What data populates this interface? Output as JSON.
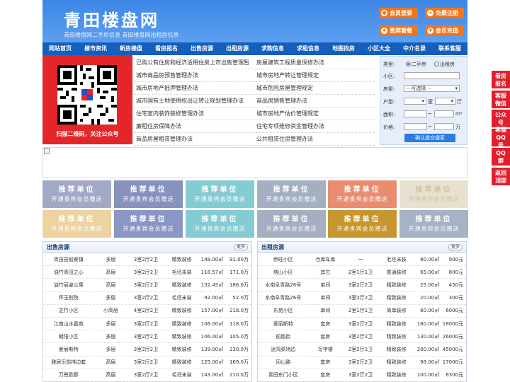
{
  "header": {
    "logo": "青田楼盘网",
    "slogan": "青田楼盘网二手房信息    青田楼盘网出租房信息",
    "buttons": [
      "会员登录",
      "免费注册",
      "贵宾套餐",
      "金币充值"
    ]
  },
  "nav": [
    "网站首页",
    "楼市资讯",
    "新房楼盘",
    "看房报名",
    "出售房源",
    "出租房源",
    "求购信息",
    "求租信息",
    "地图找房",
    "小区大全",
    "中介名录",
    "联系客服"
  ],
  "qr": {
    "caption": "扫描二维码，关注公众号"
  },
  "links": [
    [
      "已购公有住房和经济适用住房上市出售管理暂",
      "房屋建筑工程质量保修办法"
    ],
    [
      "城市商品房预售管理办法",
      "城市房地产转让管理规定"
    ],
    [
      "城市房地产抵押管理办法",
      "城市危险房屋管理规定"
    ],
    [
      "城市国有土地使用权出让转让规划管理办法",
      "商品房销售管理办法"
    ],
    [
      "住宅室内装饰装修管理办法",
      "城市房地产估价管理规定"
    ],
    [
      "廉租住房保障办法",
      "住宅专项维修资金管理办法"
    ],
    [
      "商品房屋租赁管理办法",
      "公共租赁住房管理办法"
    ]
  ],
  "search": {
    "type_label": "类型:",
    "type_options": [
      "二手房",
      "出租房"
    ],
    "area_label": "小区:",
    "style_label": "房型:",
    "style_value": "-- 可选择 --",
    "rooms_label": "户型:",
    "room_unit": "室",
    "hall_unit": "厅",
    "size_label": "面积:",
    "size_unit": "m²",
    "price_label": "价格:",
    "price_unit": "万",
    "range_sep": "~",
    "submit": "确认提交搜索"
  },
  "ads": {
    "line1": "推荐单位",
    "line2": "开通贵宾会员赠送",
    "colors": [
      "#a2a9c7",
      "#8792bf",
      "#84ccd2",
      "#a4afc1",
      "#e98c6f",
      "#e8e1cf",
      "#ecd3a0",
      "#8a97c6",
      "#84ccd2",
      "#a4afc1",
      "#c7962c",
      "#a6b2c6"
    ],
    "text_colors": [
      "#ffffff",
      "#ffffff",
      "#ffffff",
      "#ffffff",
      "#ffffff",
      "#cfc3a2",
      "#ffffff",
      "#ffffff",
      "#ffffff",
      "#ffffff",
      "#ffffff",
      "#ffffff"
    ]
  },
  "sale": {
    "title": "出售房源",
    "more": "更多",
    "rows": [
      [
        "青田县船寮镇",
        "多层",
        "3室2厅2卫",
        "精致装修",
        "148.00㎡",
        "91.00万"
      ],
      [
        "油竹青田之心",
        "高层",
        "3室2厅2卫",
        "毛坯未装",
        "118.57㎡",
        "171.0万"
      ],
      [
        "油竹丽姿公寓",
        "高层",
        "3室2厅2卫",
        "精致装修",
        "132.45㎡",
        "186.0万"
      ],
      [
        "怀玉别院",
        "多层",
        "3室2厅2卫",
        "毛坯未装",
        "92.00㎡",
        "52.0万"
      ],
      [
        "芝竹小区",
        "小高层",
        "4室2厅2卫",
        "精致装修",
        "157.00㎡",
        "218.0万"
      ],
      [
        "江南山水嘉苑",
        "多层",
        "3室2厅2卫",
        "精致装修",
        "106.00㎡",
        "118.0万"
      ],
      [
        "朝阳小区",
        "多层",
        "3室2厅2卫",
        "精致装修",
        "106.00㎡",
        "105.0万"
      ],
      [
        "爱丽斯特",
        "多层",
        "3室2厅2卫",
        "精致装修",
        "139.00㎡",
        "230.0万"
      ],
      [
        "雅居乐前排边套",
        "高层",
        "3室2厅2卫",
        "精致装修",
        "125.00㎡",
        "169.0万"
      ],
      [
        "万景欧郡",
        "高层",
        "3室2厅2卫",
        "毛坯未装",
        "143.00㎡",
        "210.0万"
      ]
    ]
  },
  "rent": {
    "title": "出租房源",
    "more": "更多",
    "rows": [
      [
        "侨旺小区",
        "仓库车库",
        "一",
        "毛坯未装",
        "80.00㎡",
        "900元"
      ],
      [
        "塔山小区",
        "其它",
        "2室1厅1卫",
        "普通装修",
        "65.00㎡",
        "800元"
      ],
      [
        "水南阜青路26号",
        "单间",
        "3室2厅2卫",
        "精致装修",
        "25.00㎡",
        "450元"
      ],
      [
        "水南阜青路26号",
        "单间",
        "3室2厅2卫",
        "精致装修",
        "20.00㎡",
        "300元"
      ],
      [
        "东苑小区",
        "单间",
        "2室1厅1卫",
        "简单装修",
        "60.00㎡",
        "6000元"
      ],
      [
        "爱丽斯特",
        "套房",
        "3室2厅2卫",
        "精致装修",
        "160.00㎡",
        "18000元"
      ],
      [
        "前路街",
        "套房",
        "3室2厅2卫",
        "精致装修",
        "130.00㎡",
        "26000元"
      ],
      [
        "泥鸿菜场边",
        "写字楼",
        "2室2厅1卫",
        "精致装修",
        "200.00㎡",
        "45000元"
      ],
      [
        "冈山路",
        "套房",
        "3室2厅2卫",
        "精致装修",
        "98.00㎡",
        "17000元"
      ],
      [
        "青田东门小区",
        "套房",
        "3室2厅2卫",
        "精致装修",
        "100.00㎡",
        "6300元"
      ]
    ]
  },
  "side": [
    "看房报名",
    "客服微信",
    "公众号",
    "客服QQ号",
    "QQ群",
    "返回顶部"
  ]
}
